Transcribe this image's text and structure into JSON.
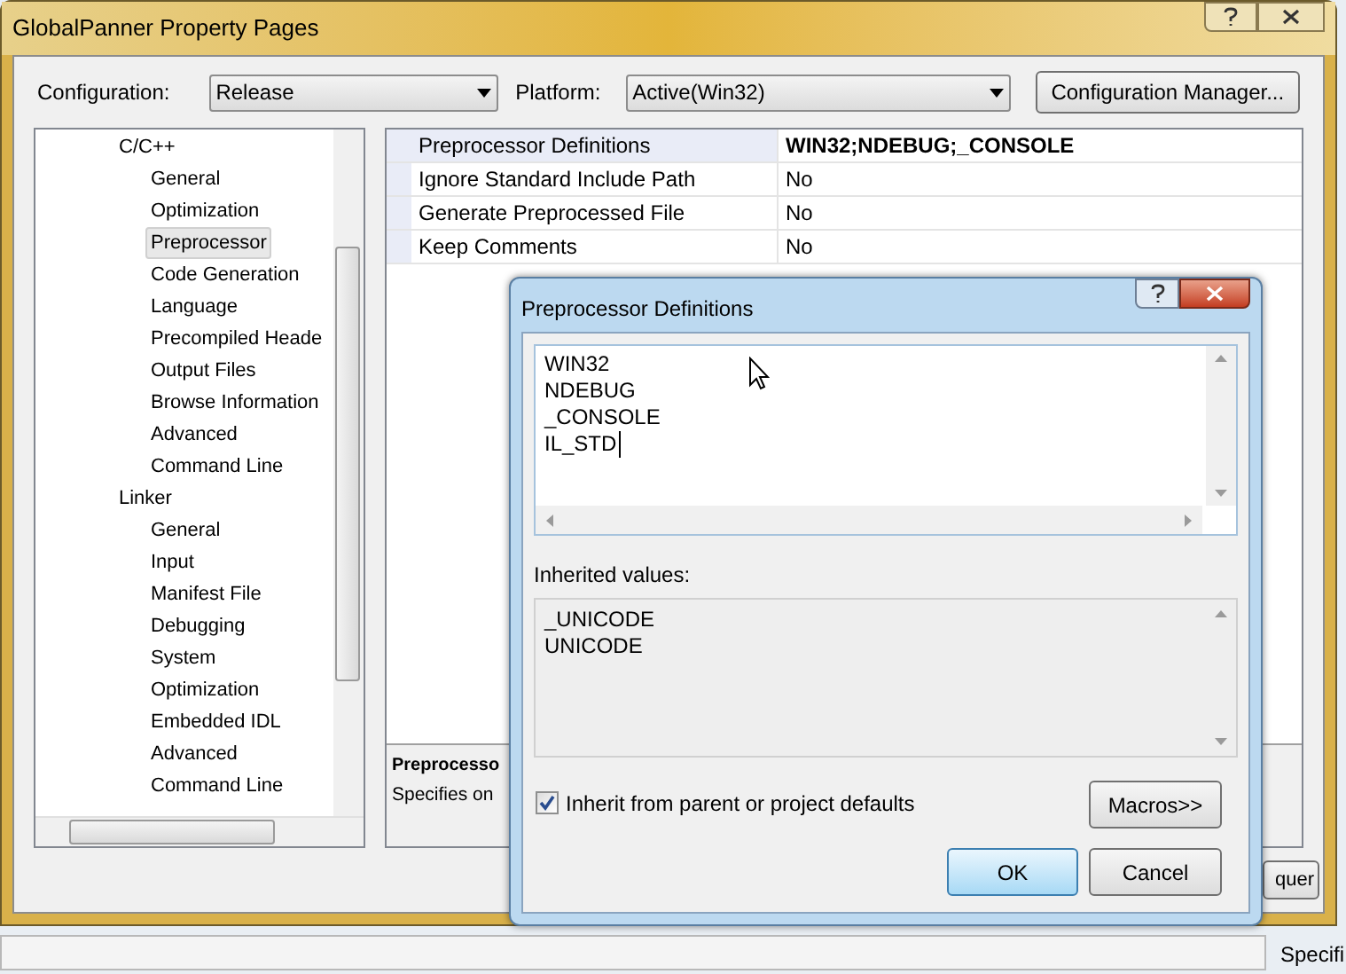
{
  "window": {
    "title": "GlobalPanner Property Pages"
  },
  "config_bar": {
    "configuration_label": "Configuration:",
    "configuration_value": "Release",
    "platform_label": "Platform:",
    "platform_value": "Active(Win32)",
    "manager_button": "Configuration Manager..."
  },
  "tree": [
    {
      "label": "C/C++",
      "selected": false,
      "children": [
        {
          "label": "General",
          "selected": false
        },
        {
          "label": "Optimization",
          "selected": false
        },
        {
          "label": "Preprocessor",
          "selected": true
        },
        {
          "label": "Code Generation",
          "selected": false
        },
        {
          "label": "Language",
          "selected": false
        },
        {
          "label": "Precompiled Heade",
          "selected": false
        },
        {
          "label": "Output Files",
          "selected": false
        },
        {
          "label": "Browse Information",
          "selected": false
        },
        {
          "label": "Advanced",
          "selected": false
        },
        {
          "label": "Command Line",
          "selected": false
        }
      ]
    },
    {
      "label": "Linker",
      "selected": false,
      "children": [
        {
          "label": "General",
          "selected": false
        },
        {
          "label": "Input",
          "selected": false
        },
        {
          "label": "Manifest File",
          "selected": false
        },
        {
          "label": "Debugging",
          "selected": false
        },
        {
          "label": "System",
          "selected": false
        },
        {
          "label": "Optimization",
          "selected": false
        },
        {
          "label": "Embedded IDL",
          "selected": false
        },
        {
          "label": "Advanced",
          "selected": false
        },
        {
          "label": "Command Line",
          "selected": false
        }
      ]
    }
  ],
  "property_grid": [
    {
      "name": "Preprocessor Definitions",
      "value": "WIN32;NDEBUG;_CONSOLE",
      "selected": true
    },
    {
      "name": "Ignore Standard Include Path",
      "value": "No",
      "selected": false
    },
    {
      "name": "Generate Preprocessed File",
      "value": "No",
      "selected": false
    },
    {
      "name": "Keep Comments",
      "value": "No",
      "selected": false
    }
  ],
  "description": {
    "title": "Preprocesso",
    "text": "Specifies on"
  },
  "footer_button": "quer",
  "background_text": "Specifi",
  "dialog": {
    "title": "Preprocessor Definitions",
    "definitions": [
      "WIN32",
      "NDEBUG",
      "_CONSOLE",
      "IL_STD"
    ],
    "inherited_label": "Inherited values:",
    "inherited_values": [
      "_UNICODE",
      "UNICODE"
    ],
    "inherit_checkbox": {
      "label": "Inherit from parent or project defaults",
      "checked": true
    },
    "macros_button": "Macros>>",
    "ok_button": "OK",
    "cancel_button": "Cancel"
  }
}
